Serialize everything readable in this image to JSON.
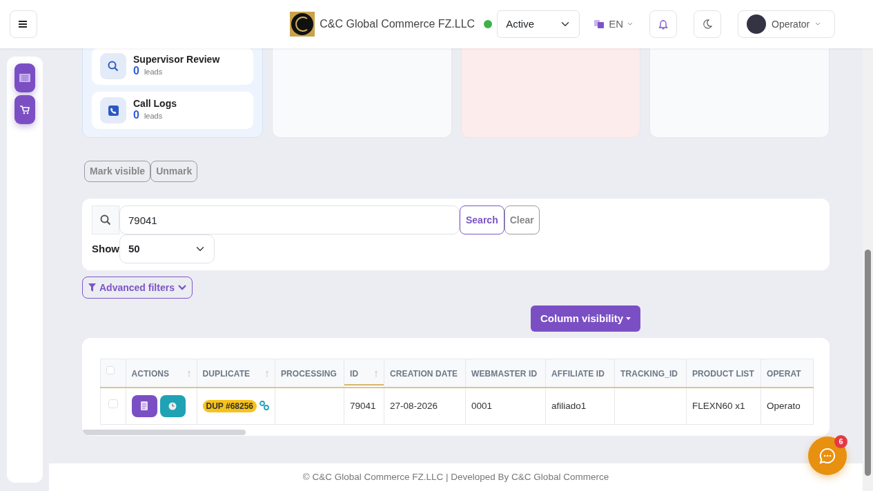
{
  "header": {
    "brand": "C&C Global Commerce FZ.LLC",
    "status": {
      "value": "Active",
      "online": true
    },
    "language": "EN",
    "language_menu_expanded": false,
    "user": "Operator"
  },
  "summary_cards": [
    {
      "kind": "search",
      "title": "Supervisor Review",
      "count": "0",
      "unit": "leads"
    },
    {
      "kind": "phone",
      "title": "Call Logs",
      "count": "0",
      "unit": "leads"
    }
  ],
  "panels": [
    {
      "color": "#f8fafc"
    },
    {
      "color": "#fdecec"
    },
    {
      "color": "#f8fafc"
    }
  ],
  "bulk_buttons": [
    "Mark visible",
    "Unmark"
  ],
  "search": {
    "value": "79041",
    "search_button": "Search",
    "clear_button": "Clear",
    "show_label": "Show",
    "page_size": "50"
  },
  "advanced_filters": "Advanced filters",
  "column_visibility": "Column visibility",
  "table": {
    "select_all_checked": false,
    "columns": [
      {
        "kind": "actions",
        "label": "ACTIONS",
        "sortable": true,
        "sorted": false
      },
      {
        "kind": "duplicate",
        "label": "DUPLICATE",
        "sortable": true,
        "sorted": false
      },
      {
        "kind": "text",
        "label": "PROCESSING",
        "sortable": false,
        "sorted": false
      },
      {
        "kind": "text",
        "label": "ID",
        "sortable": true,
        "sorted": true
      },
      {
        "kind": "text",
        "label": "CREATION DATE",
        "sortable": false,
        "sorted": false
      },
      {
        "kind": "text",
        "label": "WEBMASTER ID",
        "sortable": false,
        "sorted": false
      },
      {
        "kind": "text",
        "label": "AFFILIATE ID",
        "sortable": false,
        "sorted": false
      },
      {
        "kind": "text",
        "label": "TRACKING_ID",
        "sortable": false,
        "sorted": false
      },
      {
        "kind": "text",
        "label": "PRODUCT LIST",
        "sortable": false,
        "sorted": false
      },
      {
        "kind": "text",
        "label": "OPERAT",
        "sortable": false,
        "sorted": false
      }
    ],
    "rows": [
      {
        "checked": false,
        "cells": [
          null,
          "DUP #68256",
          null,
          "79041",
          "27-08-2026",
          "0001",
          "afiliado1",
          null,
          "FLEXN60 x1",
          "Operato"
        ]
      }
    ]
  },
  "footer": "© C&C Global Commerce FZ.LLC | Developed By C&C Global Commerce",
  "chat": {
    "badge": "6"
  }
}
